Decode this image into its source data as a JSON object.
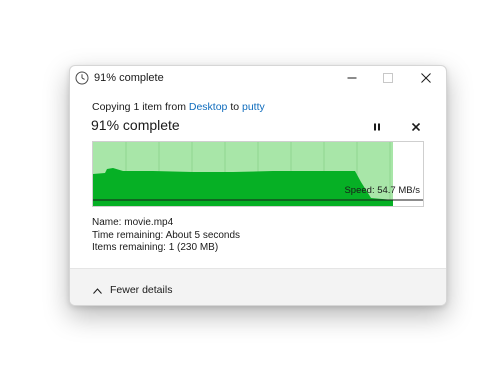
{
  "window": {
    "title": "91% complete",
    "icon": "clock-icon"
  },
  "titlebar_buttons": {
    "minimize": "minimize-icon",
    "maximize": "maximize-icon",
    "close": "close-icon"
  },
  "copy": {
    "prefix": "Copying 1 item from ",
    "source": "Desktop",
    "connector": " to ",
    "destination": "putty",
    "status": "91% complete",
    "percent": 91
  },
  "controls": {
    "pause": "pause-icon",
    "cancel": "cancel-icon"
  },
  "graph": {
    "speed_label": "Speed: 54.7 MB/s",
    "progress_fraction": 0.91,
    "colors": {
      "remaining_bg": "#ffffff",
      "completed_bg": "#a8e6a8",
      "fill": "#06b025",
      "speed_line": "#1a1a1a",
      "grid": "#8fd68f"
    }
  },
  "details": {
    "name_label": "Name:",
    "name_value": "movie.mp4",
    "time_label": "Time remaining:",
    "time_value": "About 5 seconds",
    "items_label": "Items remaining:",
    "items_value": "1 (230 MB)"
  },
  "footer": {
    "toggle_label": "Fewer details",
    "toggle_icon": "chevron-up-icon"
  }
}
